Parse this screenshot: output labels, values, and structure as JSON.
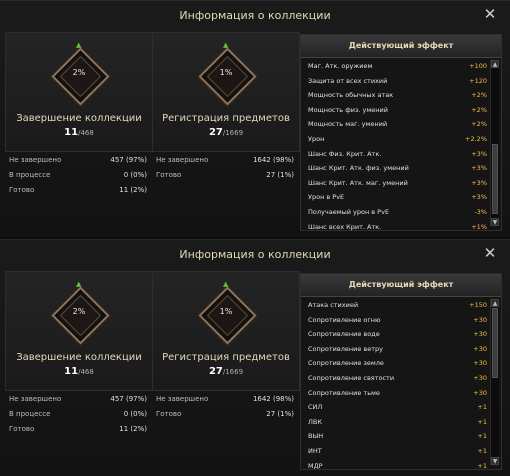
{
  "windows": [
    {
      "title": "Информация о коллекции",
      "completion": {
        "percent": "2%",
        "label": "Завершение коллекции",
        "count": "11",
        "total": "/468"
      },
      "registration": {
        "percent": "1%",
        "label": "Регистрация предметов",
        "count": "27",
        "total": "/1669"
      },
      "completion_stats": [
        {
          "k": "Не завершено",
          "v": "457 (97%)"
        },
        {
          "k": "В процессе",
          "v": "0 (0%)"
        },
        {
          "k": "Готово",
          "v": "11 (2%)"
        }
      ],
      "registration_stats": [
        {
          "k": "Не завершено",
          "v": "1642 (98%)"
        },
        {
          "k": "Готово",
          "v": "27 (1%)"
        }
      ],
      "effects_title": "Действующий эффект",
      "effects": [
        {
          "k": "Маг. Атк. оружием",
          "v": "+100"
        },
        {
          "k": "Защита от всех стихий",
          "v": "+120"
        },
        {
          "k": "Мощность обычных атак",
          "v": "+2%"
        },
        {
          "k": "Мощность физ. умений",
          "v": "+2%"
        },
        {
          "k": "Мощность маг. умений",
          "v": "+2%"
        },
        {
          "k": "Урон",
          "v": "+2.2%"
        },
        {
          "k": "Шанс Физ. Крит. Атк.",
          "v": "+3%"
        },
        {
          "k": "Шанс Крит. Атк. физ. умений",
          "v": "+3%"
        },
        {
          "k": "Шанс Крит. Атк. маг. умений",
          "v": "+3%"
        },
        {
          "k": "Урон в PvE",
          "v": "+3%"
        },
        {
          "k": "Получаемый урон в PvE",
          "v": "-3%"
        },
        {
          "k": "Шанс всех Крит. Атк.",
          "v": "+1%"
        }
      ]
    },
    {
      "title": "Информация о коллекции",
      "completion": {
        "percent": "2%",
        "label": "Завершение коллекции",
        "count": "11",
        "total": "/468"
      },
      "registration": {
        "percent": "1%",
        "label": "Регистрация предметов",
        "count": "27",
        "total": "/1669"
      },
      "completion_stats": [
        {
          "k": "Не завершено",
          "v": "457 (97%)"
        },
        {
          "k": "В процессе",
          "v": "0 (0%)"
        },
        {
          "k": "Готово",
          "v": "11 (2%)"
        }
      ],
      "registration_stats": [
        {
          "k": "Не завершено",
          "v": "1642 (98%)"
        },
        {
          "k": "Готово",
          "v": "27 (1%)"
        }
      ],
      "effects_title": "Действующий эффект",
      "effects": [
        {
          "k": "Атака стихией",
          "v": "+150"
        },
        {
          "k": "Сопротивление огню",
          "v": "+30"
        },
        {
          "k": "Сопротивление воде",
          "v": "+30"
        },
        {
          "k": "Сопротивление ветру",
          "v": "+30"
        },
        {
          "k": "Сопротивление земле",
          "v": "+30"
        },
        {
          "k": "Сопротивление святости",
          "v": "+30"
        },
        {
          "k": "Сопротивление тьме",
          "v": "+30"
        },
        {
          "k": "СИЛ",
          "v": "+1"
        },
        {
          "k": "ЛВК",
          "v": "+1"
        },
        {
          "k": "ВЫН",
          "v": "+1"
        },
        {
          "k": "ИНТ",
          "v": "+1"
        },
        {
          "k": "МДР",
          "v": "+1"
        }
      ]
    }
  ],
  "colors": {
    "accent": "#e4d9b8",
    "value": "#f0c040",
    "leaf": "#6cba3c"
  },
  "icons": {
    "close": "close-icon",
    "leaf": "leaf-icon",
    "scroll_up": "arrow-up-icon",
    "scroll_down": "arrow-down-icon"
  }
}
